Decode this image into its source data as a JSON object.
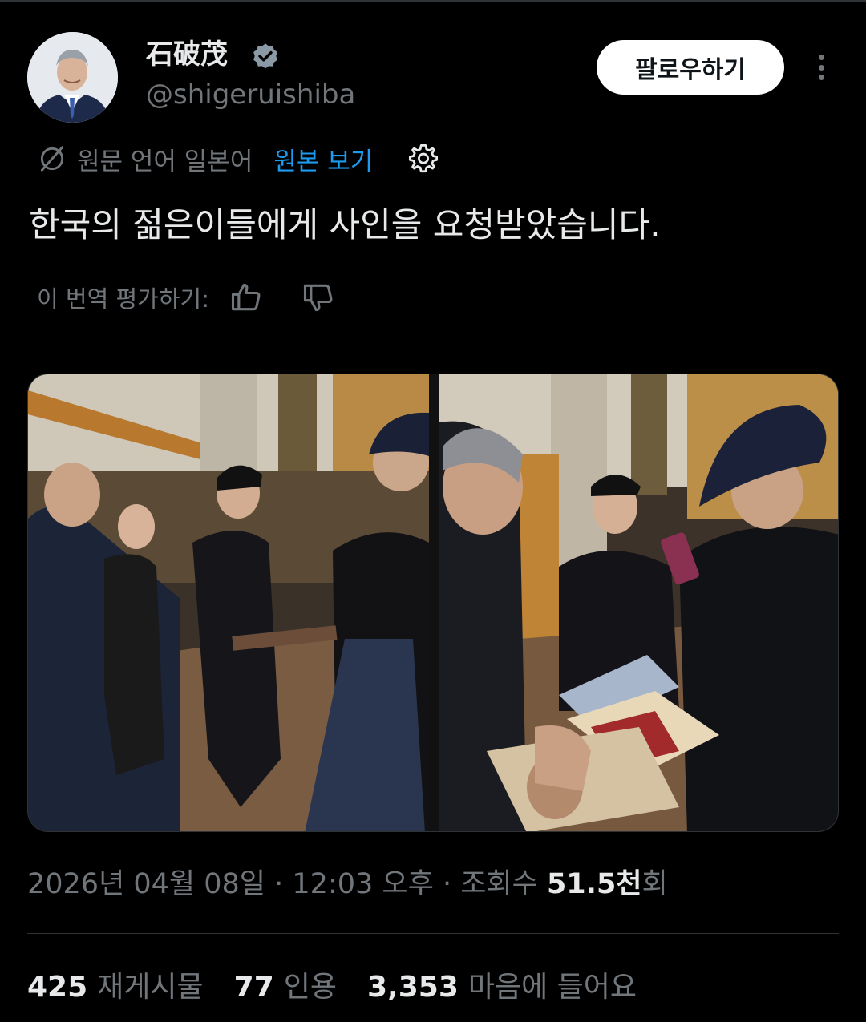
{
  "user": {
    "display_name": "石破茂",
    "handle": "@shigeruishiba",
    "verified_icon": "verified-badge-icon",
    "accent_color": "#1d9bf0"
  },
  "header": {
    "follow_label": "팔로우하기",
    "more_icon": "more-vertical-icon"
  },
  "translation": {
    "source_text": "원문 언어 일본어",
    "view_original": "원본 보기",
    "settings_icon": "gear-icon"
  },
  "tweet": {
    "text": "한국의 젊은이들에게 사인을 요청받았습니다."
  },
  "rating": {
    "label": "이 번역 평가하기:"
  },
  "meta": {
    "date": "2026년 04월 08일",
    "time": "12:03 오후",
    "views_label": "조회수",
    "views_count": "51.5천",
    "views_suffix": "회"
  },
  "stats": [
    {
      "count": "425",
      "label": "재게시물"
    },
    {
      "count": "77",
      "label": "인용"
    },
    {
      "count": "3,353",
      "label": "마음에 들어요"
    }
  ]
}
